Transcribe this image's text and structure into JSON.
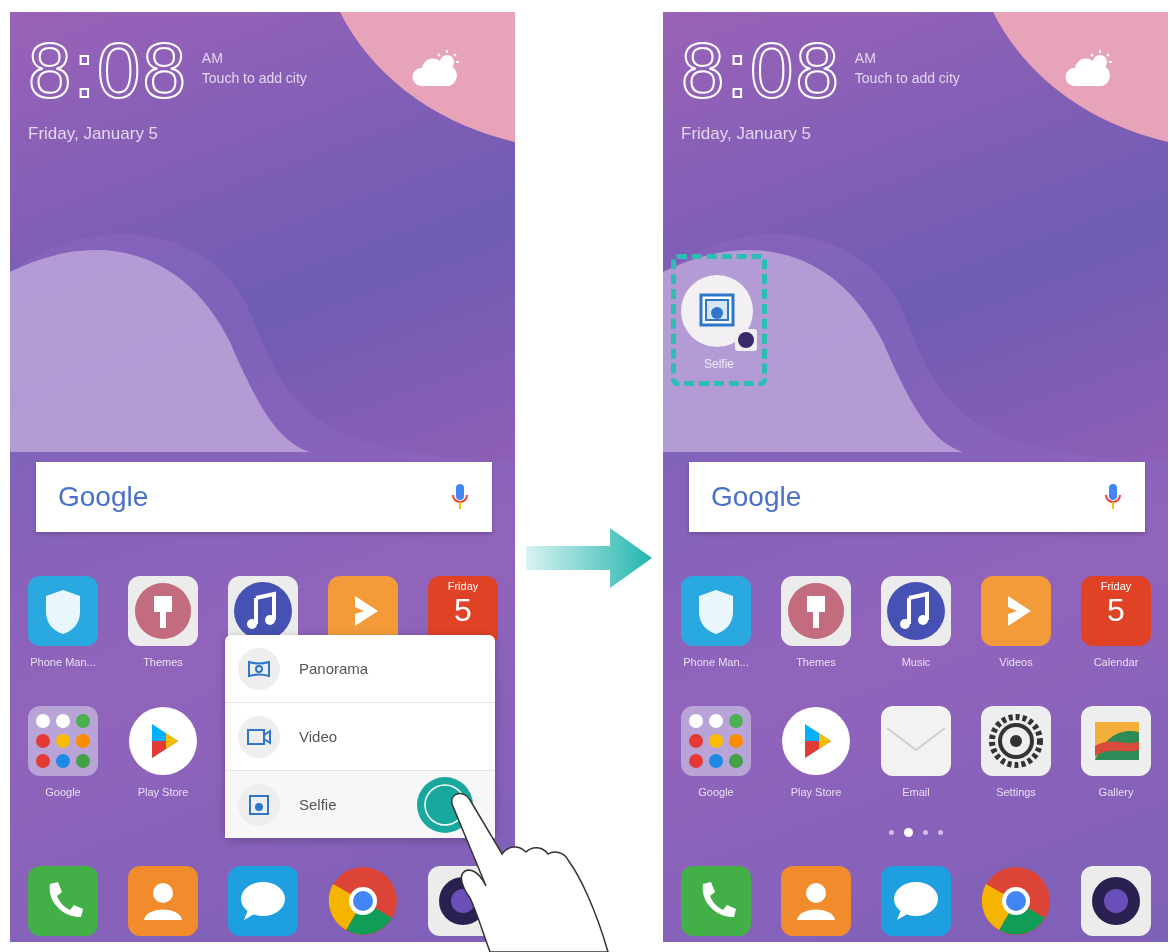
{
  "screens": [
    {
      "clock": {
        "time": "8:08",
        "ampm": "AM",
        "city_hint": "Touch to add city",
        "date": "Friday, January 5"
      },
      "search": {
        "brand": "Google"
      },
      "apps": [
        {
          "kind": "shield",
          "label": "Phone Man..."
        },
        {
          "kind": "themes",
          "label": "Themes"
        },
        {
          "kind": "music"
        },
        {
          "kind": "videos"
        },
        {
          "kind": "calendar",
          "day": "Friday",
          "date": "5"
        },
        {
          "kind": "folder",
          "label": "Google"
        },
        {
          "kind": "play",
          "label": "Play Store"
        }
      ],
      "shortcut_menu": {
        "items": [
          {
            "kind": "panorama",
            "label": "Panorama",
            "selected": false
          },
          {
            "kind": "video",
            "label": "Video",
            "selected": false
          },
          {
            "kind": "selfie",
            "label": "Selfie",
            "selected": true
          }
        ]
      },
      "dock": [
        {
          "kind": "phone"
        },
        {
          "kind": "contacts"
        },
        {
          "kind": "messages"
        },
        {
          "kind": "chrome"
        },
        {
          "kind": "camera"
        }
      ]
    },
    {
      "clock": {
        "time": "8:08",
        "ampm": "AM",
        "city_hint": "Touch to add city",
        "date": "Friday, January 5"
      },
      "pinned_shortcut": {
        "label": "Selfie"
      },
      "search": {
        "brand": "Google"
      },
      "apps": [
        {
          "kind": "shield",
          "label": "Phone Man..."
        },
        {
          "kind": "themes",
          "label": "Themes"
        },
        {
          "kind": "music",
          "label": "Music"
        },
        {
          "kind": "videos",
          "label": "Videos"
        },
        {
          "kind": "calendar",
          "day": "Friday",
          "date": "5",
          "label": "Calendar"
        },
        {
          "kind": "folder",
          "label": "Google"
        },
        {
          "kind": "play",
          "label": "Play Store"
        },
        {
          "kind": "email",
          "label": "Email"
        },
        {
          "kind": "settings",
          "label": "Settings"
        },
        {
          "kind": "gallery",
          "label": "Gallery"
        }
      ],
      "page_dots": [
        {
          "selected": false
        },
        {
          "selected": true
        },
        {
          "selected": false
        },
        {
          "selected": false
        }
      ],
      "dock": [
        {
          "kind": "phone"
        },
        {
          "kind": "contacts"
        },
        {
          "kind": "messages"
        },
        {
          "kind": "chrome"
        },
        {
          "kind": "camera"
        }
      ]
    }
  ]
}
